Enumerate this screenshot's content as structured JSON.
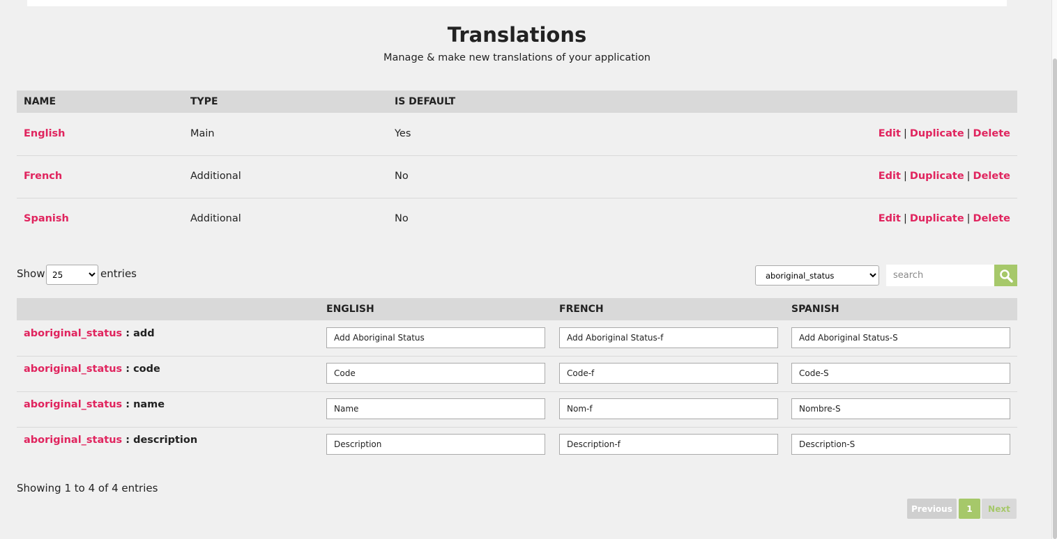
{
  "header": {
    "title": "Translations",
    "subtitle": "Manage & make new translations of your application"
  },
  "languages_table": {
    "columns": [
      "NAME",
      "TYPE",
      "IS DEFAULT"
    ],
    "rows": [
      {
        "name": "English",
        "type": "Main",
        "is_default": "Yes"
      },
      {
        "name": "French",
        "type": "Additional",
        "is_default": "No"
      },
      {
        "name": "Spanish",
        "type": "Additional",
        "is_default": "No"
      }
    ],
    "actions": {
      "edit": "Edit",
      "separator": "|",
      "duplicate": "Duplicate",
      "delete": "Delete"
    }
  },
  "controls": {
    "show_label": "Show",
    "entries_label": "entries",
    "page_size": "25",
    "category": "aboriginal_status",
    "search_placeholder": "search",
    "search_icon": "magnifier-icon",
    "accent_color": "#a6c86a",
    "link_color": "#e0245e"
  },
  "translations_table": {
    "columns": [
      "",
      "ENGLISH",
      "FRENCH",
      "SPANISH"
    ],
    "rows": [
      {
        "group": "aboriginal_status",
        "key": ": add",
        "english": "Add Aboriginal Status",
        "french": "Add Aboriginal Status-f",
        "spanish": "Add Aboriginal Status-S"
      },
      {
        "group": "aboriginal_status",
        "key": ": code",
        "english": "Code",
        "french": "Code-f",
        "spanish": "Code-S"
      },
      {
        "group": "aboriginal_status",
        "key": ": name",
        "english": "Name",
        "french": "Nom-f",
        "spanish": "Nombre-S"
      },
      {
        "group": "aboriginal_status",
        "key": ": description",
        "english": "Description",
        "french": "Description-f",
        "spanish": "Description-S"
      }
    ]
  },
  "footer": {
    "info": "Showing 1 to 4 of 4 entries",
    "pagination": {
      "previous": "Previous",
      "current": "1",
      "next": "Next"
    }
  }
}
